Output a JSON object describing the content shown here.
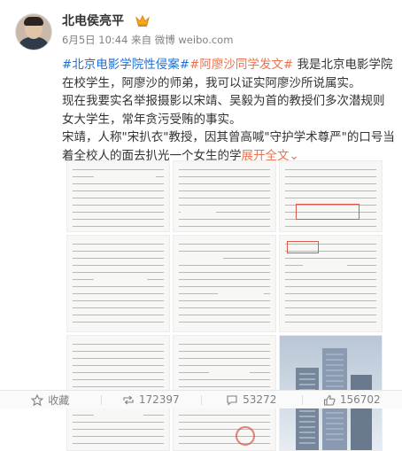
{
  "post": {
    "username": "北电侯亮平",
    "badge_icon": "crown-icon",
    "meta": "6月5日 10:44 来自 微博 weibo.com",
    "line1_tag1": "#北京电影学院性侵案#",
    "line1_tag2": "#阿廖沙同学发文#",
    "line1_rest": " 我是北京电影学院在校学生，阿廖沙的师弟，我可以证实阿廖沙所说属实。",
    "para2": "现在我要实名举报摄影以宋靖、吴毅为首的教授们多次潜规则女大学生，常年贪污受贿的事实。",
    "para3": "宋靖，人称\"宋扒衣\"教授，因其曾高喊\"守护学术尊严\"的口号当着全校人的面去扒光一个女生的学",
    "expand_label": "展开全文",
    "expand_icon": "chevron-down-icon"
  },
  "images": [
    {
      "kind": "document"
    },
    {
      "kind": "document"
    },
    {
      "kind": "document"
    },
    {
      "kind": "document"
    },
    {
      "kind": "document"
    },
    {
      "kind": "document"
    },
    {
      "kind": "document"
    },
    {
      "kind": "document"
    },
    {
      "kind": "photo"
    }
  ],
  "actions": {
    "favorite_label": "收藏",
    "favorite_icon": "star-icon",
    "repost_count": "172397",
    "repost_icon": "repost-icon",
    "comment_count": "53272",
    "comment_icon": "comment-icon",
    "like_count": "156702",
    "like_icon": "thumbs-up-icon"
  },
  "colors": {
    "hashtag": "#eb7350",
    "link": "#1e6fd1",
    "muted": "#808080"
  }
}
